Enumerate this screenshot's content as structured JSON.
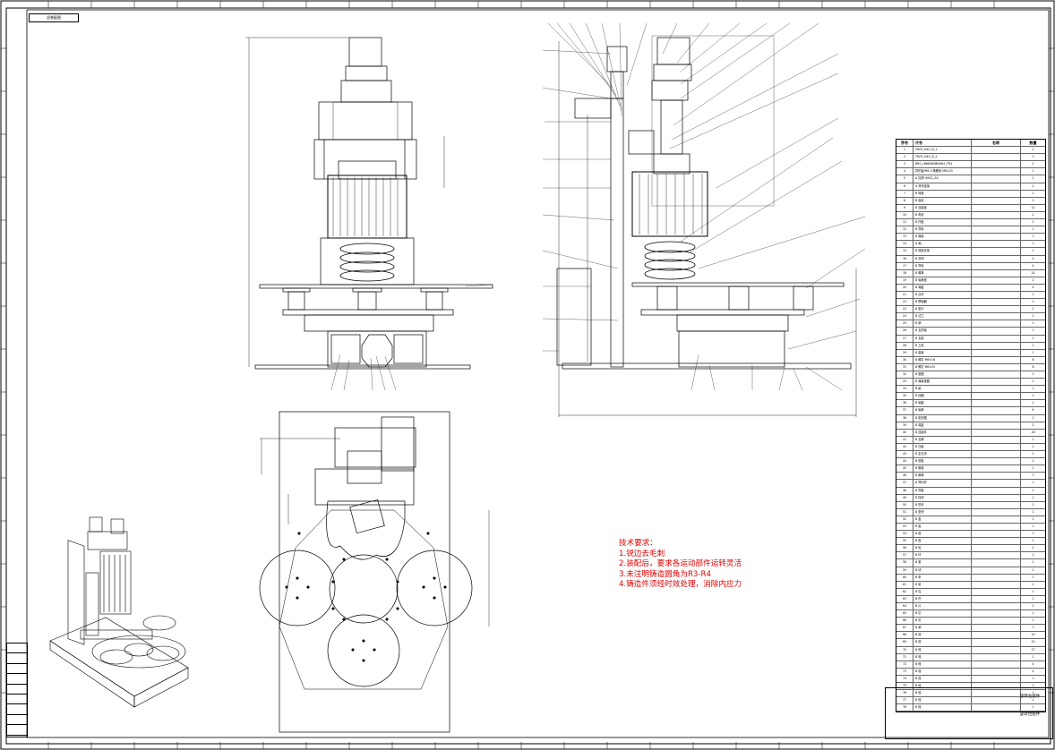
{
  "drawing": {
    "top_label": "总装配图",
    "grid_columns": [
      "1",
      "2",
      "3",
      "4",
      "5",
      "6",
      "7",
      "8",
      "9",
      "10",
      "11",
      "12",
      "13",
      "14",
      "15",
      "16",
      "17",
      "18",
      "19",
      "20",
      "21",
      "22",
      "23",
      "24"
    ],
    "grid_rows": [
      "A",
      "B",
      "C",
      "D",
      "E",
      "F",
      "G",
      "H",
      "I",
      "J",
      "K",
      "L",
      "M",
      "N",
      "O",
      "P",
      "Q"
    ]
  },
  "tech_requirements": {
    "heading": "技术要求：",
    "items": [
      "1.锐边去毛刺",
      "2.装配后，要求各运动部件运转灵活",
      "3.未注明铸造圆角为R3-R4",
      "4.铸造件须经时效处理，消除内应力"
    ]
  },
  "bom": {
    "headers": [
      "序号",
      "代号",
      "名称",
      "数量"
    ],
    "rows": [
      [
        "1",
        "YRZ3_H4O_D_1",
        "",
        "1"
      ],
      [
        "2",
        "YRZ3_H4O_D_2",
        "",
        "1"
      ],
      [
        "3",
        "BRS_LB68360BD6H4_TR4",
        "",
        "1"
      ],
      [
        "4",
        "异形板/M6 六角螺栓 M6×20",
        "",
        "1"
      ],
      [
        "5",
        "A 拉伸 HXSG_ZA",
        "",
        "1"
      ],
      [
        "6",
        "A 滑块连接",
        "",
        "1"
      ],
      [
        "7",
        "B 转盘",
        "",
        "1"
      ],
      [
        "8",
        "B 齿轮",
        "",
        "1"
      ],
      [
        "9",
        "B 连接板",
        "",
        "12"
      ],
      [
        "10",
        "B 电机",
        "",
        "2"
      ],
      [
        "11",
        "B 托板",
        "",
        "1"
      ],
      [
        "12",
        "B 导轨",
        "",
        "1"
      ],
      [
        "13",
        "B 弹簧",
        "",
        "1"
      ],
      [
        "14",
        "A 轴",
        "",
        "1"
      ],
      [
        "15",
        "B 底座支架",
        "",
        "1"
      ],
      [
        "16",
        "B 滑块",
        "",
        "4"
      ],
      [
        "17",
        "B 导轨",
        "",
        "4"
      ],
      [
        "18",
        "B 螺母",
        "",
        "24"
      ],
      [
        "19",
        "B 轴承座",
        "",
        "2"
      ],
      [
        "20",
        "B 端盖",
        "",
        "4"
      ],
      [
        "21",
        "B 丝杆",
        "",
        "1"
      ],
      [
        "22",
        "B 联轴器",
        "",
        "1"
      ],
      [
        "23",
        "B 垫片",
        "",
        "2"
      ],
      [
        "24",
        "B 法兰",
        "",
        "2"
      ],
      [
        "25",
        "B 销",
        "",
        "1"
      ],
      [
        "26",
        "B 支撑板",
        "",
        "1"
      ],
      [
        "27",
        "B 支架",
        "",
        "1"
      ],
      [
        "28",
        "B 立柱",
        "",
        "1"
      ],
      [
        "29",
        "B 盖板",
        "",
        "1"
      ],
      [
        "30",
        "B 螺钉 M6×16",
        "",
        "8"
      ],
      [
        "31",
        "B 螺钉 M8×20",
        "",
        "8"
      ],
      [
        "32",
        "B 垫圈",
        "",
        "1"
      ],
      [
        "33",
        "B 弹簧垫圈",
        "",
        "1"
      ],
      [
        "34",
        "B 键",
        "",
        "1"
      ],
      [
        "35",
        "B 挡圈",
        "",
        "1"
      ],
      [
        "36",
        "B 轴套",
        "",
        "1"
      ],
      [
        "37",
        "B 轴承",
        "",
        "6"
      ],
      [
        "38",
        "B 密封圈",
        "",
        "1"
      ],
      [
        "39",
        "B 端盖",
        "",
        "2"
      ],
      [
        "40",
        "B 连接件",
        "",
        "16"
      ],
      [
        "41",
        "B 支脚",
        "",
        "1"
      ],
      [
        "42",
        "B 压板",
        "",
        "1"
      ],
      [
        "43",
        "B 定位块",
        "",
        "1"
      ],
      [
        "44",
        "B 底板",
        "",
        "1"
      ],
      [
        "45",
        "B 螺栓",
        "",
        "1"
      ],
      [
        "46",
        "B 螺母",
        "",
        "1"
      ],
      [
        "47",
        "B 导向杆",
        "",
        "1"
      ],
      [
        "48",
        "B 导套",
        "",
        "1"
      ],
      [
        "49",
        "B 挡块",
        "",
        "1"
      ],
      [
        "50",
        "B 把手",
        "",
        "1"
      ],
      [
        "51",
        "B 垫块",
        "",
        "1"
      ],
      [
        "52",
        "B 盖",
        "",
        "1"
      ],
      [
        "53",
        "B 板",
        "",
        "1"
      ],
      [
        "54",
        "B 座",
        "",
        "1"
      ],
      [
        "55",
        "B 盘",
        "",
        "1"
      ],
      [
        "56",
        "B 轮",
        "",
        "1"
      ],
      [
        "57",
        "B 环",
        "",
        "1"
      ],
      [
        "58",
        "B 套",
        "",
        "1"
      ],
      [
        "59",
        "B 块",
        "",
        "1"
      ],
      [
        "60",
        "B 条",
        "",
        "1"
      ],
      [
        "61",
        "B 架",
        "",
        "1"
      ],
      [
        "62",
        "B 柱",
        "",
        "1"
      ],
      [
        "63",
        "B 杆",
        "",
        "1"
      ],
      [
        "64",
        "B 片",
        "",
        "1"
      ],
      [
        "65",
        "B 钉",
        "",
        "1"
      ],
      [
        "66",
        "B 钉",
        "",
        "1"
      ],
      [
        "67",
        "B 销",
        "",
        "1"
      ],
      [
        "68",
        "B 栓",
        "",
        "10"
      ],
      [
        "69",
        "B 栓",
        "",
        "10"
      ],
      [
        "70",
        "B 栓",
        "",
        "17"
      ],
      [
        "71",
        "B 栓",
        "",
        "1"
      ],
      [
        "72",
        "B 栓",
        "",
        "4"
      ],
      [
        "73",
        "B 栓",
        "",
        "4"
      ],
      [
        "74",
        "B 栓",
        "",
        "1"
      ],
      [
        "75",
        "B 栓",
        "",
        "1"
      ],
      [
        "76",
        "B 栓",
        "",
        "1"
      ],
      [
        "77",
        "B 栓",
        "",
        "1"
      ],
      [
        "78",
        "B 栓",
        "",
        "1"
      ]
    ]
  },
  "title_block": {
    "drawing_name": "旋转台组件",
    "drawing_name_2": "旋转台组件"
  },
  "side_block": {
    "rows": [
      "",
      "",
      "",
      "",
      "",
      "",
      "",
      "",
      "",
      ""
    ]
  }
}
